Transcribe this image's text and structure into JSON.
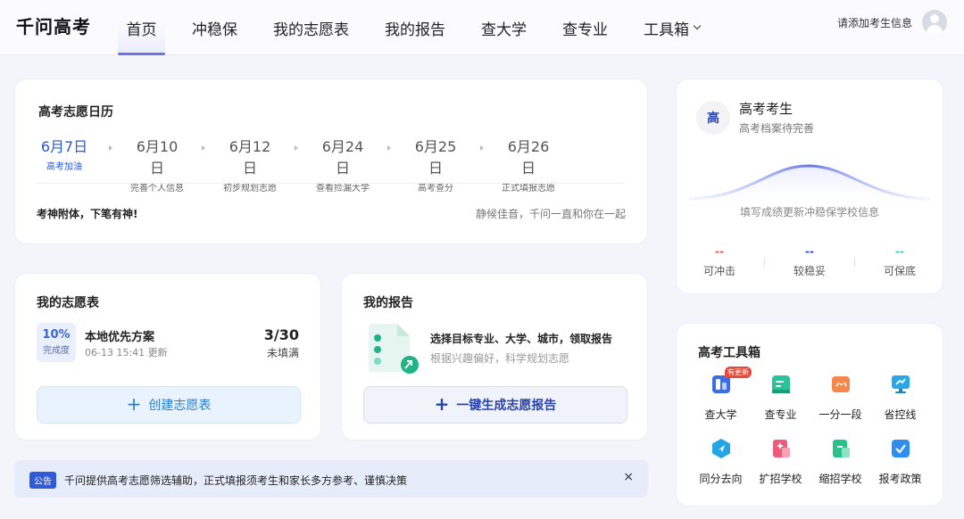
{
  "app": {
    "logo": "千问高考"
  },
  "nav": {
    "items": [
      {
        "label": "首页"
      },
      {
        "label": "冲稳保"
      },
      {
        "label": "我的志愿表"
      },
      {
        "label": "我的报告"
      },
      {
        "label": "查大学"
      },
      {
        "label": "查专业"
      },
      {
        "label": "工具箱"
      }
    ],
    "add_info": "请添加考生信息"
  },
  "calendar": {
    "title": "高考志愿日历",
    "steps": [
      {
        "date": "6月7日",
        "label": "高考加油"
      },
      {
        "date": "6月10日",
        "label": "完善个人信息"
      },
      {
        "date": "6月12日",
        "label": "初步规划志愿"
      },
      {
        "date": "6月24日",
        "label": "查看捡漏大学"
      },
      {
        "date": "6月25日",
        "label": "高考查分"
      },
      {
        "date": "6月26日",
        "label": "正式填报志愿"
      }
    ],
    "slogan": "考神附体，下笔有神!",
    "wish": "静候佳音，千问一直和你在一起"
  },
  "wishlist": {
    "title": "我的志愿表",
    "percent": "10%",
    "percent_label": "完成度",
    "plan_name": "本地优先方案",
    "plan_time": "06-13 15:41 更新",
    "count": "3/30",
    "unfilled": "未填满",
    "create_label": "创建志愿表"
  },
  "report": {
    "title": "我的报告",
    "line1": "选择目标专业、大学、城市，领取报告",
    "line2": "根据兴趣偏好，科学规划志愿",
    "button_label": "一键生成志愿报告"
  },
  "notice": {
    "tag": "公告",
    "text": "千问提供高考志愿筛选辅助，正式填报须考生和家长多方参考、谨慎决策",
    "close": "×"
  },
  "profile": {
    "badge": "高",
    "name": "高考考生",
    "sub": "高考档案待完善",
    "curve_text": "填写成绩更新冲稳保学校信息",
    "stats": [
      {
        "value": "--",
        "label": "可冲击",
        "color": "#e8554a"
      },
      {
        "value": "--",
        "label": "较稳妥",
        "color": "#2b3fd6"
      },
      {
        "value": "--",
        "label": "可保底",
        "color": "#3cc7c4"
      }
    ]
  },
  "toolbox": {
    "title": "高考工具箱",
    "tools": [
      {
        "name": "查大学",
        "icon": "university-icon",
        "color": "#3a6ee8",
        "badge": "有更新"
      },
      {
        "name": "查专业",
        "icon": "major-icon",
        "color": "#2bc29a"
      },
      {
        "name": "一分一段",
        "icon": "score-segment-icon",
        "color": "#f5874d"
      },
      {
        "name": "省控线",
        "icon": "control-line-icon",
        "color": "#2aa8e6"
      },
      {
        "name": "同分去向",
        "icon": "same-score-icon",
        "color": "#25a5e6"
      },
      {
        "name": "扩招学校",
        "icon": "expansion-icon",
        "color": "#ef5a7a"
      },
      {
        "name": "缩招学校",
        "icon": "reduction-icon",
        "color": "#2bc28a"
      },
      {
        "name": "报考政策",
        "icon": "policy-icon",
        "color": "#2e8ef0"
      }
    ]
  }
}
